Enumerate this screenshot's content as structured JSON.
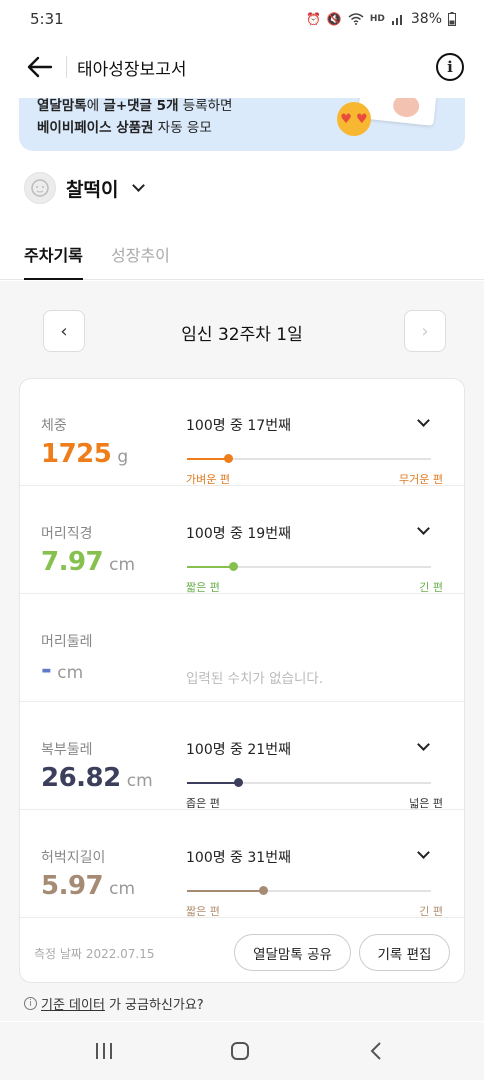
{
  "status_bar": {
    "time": "5:31",
    "battery": "38%",
    "network": "HD"
  },
  "header": {
    "title": "태아성장보고서"
  },
  "banner": {
    "line1_bold_a": "열달맘톡",
    "line1_text_a": "에 ",
    "line1_bold_b": "글+댓글 5개",
    "line1_text_b": " 등록하면",
    "line2_bold": "베이비페이스 상품권",
    "line2_text": " 자동 응모"
  },
  "baby": {
    "name": "찰떡이"
  },
  "tabs": {
    "active": "주차기록",
    "inactive": "성장추이"
  },
  "week": {
    "title": "임신 32주차 1일"
  },
  "rows": [
    {
      "label": "체중",
      "value": "1725",
      "unit": "g",
      "rank": "100명 중 17번째",
      "left": "가벼운 편",
      "right": "무거운 편",
      "percent": 17,
      "color": "#ee7d1a",
      "label_color": "#e07a20"
    },
    {
      "label": "머리직경",
      "value": "7.97",
      "unit": "cm",
      "rank": "100명 중 19번째",
      "left": "짧은 편",
      "right": "긴 편",
      "percent": 19,
      "color": "#86c04f",
      "label_color": "#6ab04a"
    },
    {
      "label": "머리둘레",
      "value": "-",
      "unit": "cm",
      "empty": "입력된 수치가 없습니다.",
      "color": "#5b7bc8"
    },
    {
      "label": "복부둘레",
      "value": "26.82",
      "unit": "cm",
      "rank": "100명 중 21번째",
      "left": "좁은 편",
      "right": "넓은 편",
      "percent": 21,
      "color": "#3c3f5c",
      "label_color": "#333333"
    },
    {
      "label": "허벅지길이",
      "value": "5.97",
      "unit": "cm",
      "rank": "100명 중 31번째",
      "left": "짧은 편",
      "right": "긴 편",
      "percent": 31,
      "color": "#a68b74",
      "label_color": "#b08f70"
    }
  ],
  "footer": {
    "measured_label": "측정 날짜",
    "measured_date": "2022.07.15",
    "share_button": "열달맘톡 공유",
    "edit_button": "기록 편집"
  },
  "faq": {
    "link": "기준 데이터",
    "suffix": "가 궁금하신가요?"
  }
}
